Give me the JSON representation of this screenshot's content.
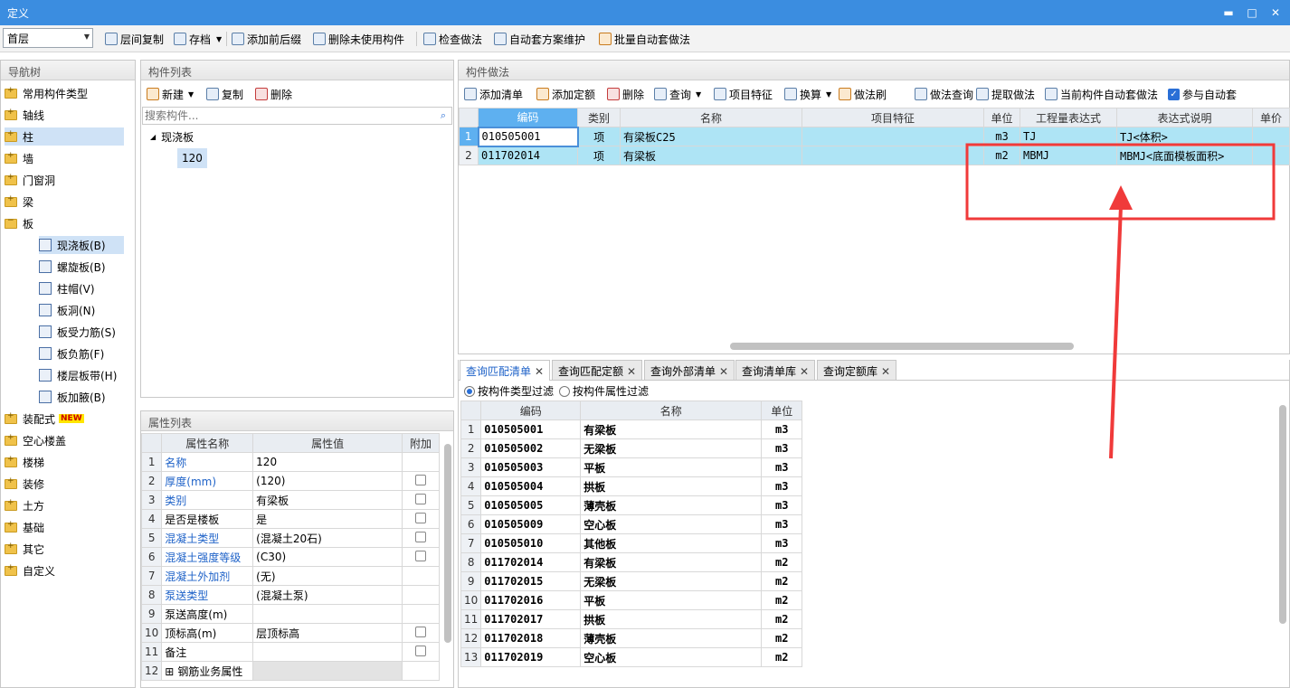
{
  "window": {
    "title": "定义",
    "min": "▬",
    "max": "□",
    "close": "✕"
  },
  "toolbar": {
    "floor": "首层",
    "buttons": [
      "层间复制",
      "存档",
      "添加前后缀",
      "删除未使用构件",
      "检查做法",
      "自动套方案维护",
      "批量自动套做法"
    ]
  },
  "nav": {
    "title": "导航树",
    "items": [
      {
        "label": "常用构件类型"
      },
      {
        "label": "轴线"
      },
      {
        "label": "柱"
      },
      {
        "label": "墙"
      },
      {
        "label": "门窗洞"
      },
      {
        "label": "梁"
      },
      {
        "label": "板"
      },
      {
        "label": "现浇板(B)"
      },
      {
        "label": "螺旋板(B)"
      },
      {
        "label": "柱帽(V)"
      },
      {
        "label": "板洞(N)"
      },
      {
        "label": "板受力筋(S)"
      },
      {
        "label": "板负筋(F)"
      },
      {
        "label": "楼层板带(H)"
      },
      {
        "label": "板加腋(B)"
      },
      {
        "label": "装配式",
        "badge": "NEW"
      },
      {
        "label": "空心楼盖"
      },
      {
        "label": "楼梯"
      },
      {
        "label": "装修"
      },
      {
        "label": "土方"
      },
      {
        "label": "基础"
      },
      {
        "label": "其它"
      },
      {
        "label": "自定义"
      }
    ]
  },
  "components": {
    "title": "构件列表",
    "new": "新建",
    "copy": "复制",
    "delete": "删除",
    "search_placeholder": "搜索构件...",
    "group": "现浇板",
    "item": "120"
  },
  "props": {
    "title": "属性列表",
    "headers": [
      "属性名称",
      "属性值",
      "附加"
    ],
    "rows": [
      {
        "n": "1",
        "name": "名称",
        "value": "120"
      },
      {
        "n": "2",
        "name": "厚度(mm)",
        "value": "(120)"
      },
      {
        "n": "3",
        "name": "类别",
        "value": "有梁板"
      },
      {
        "n": "4",
        "name": "是否是楼板",
        "value": "是"
      },
      {
        "n": "5",
        "name": "混凝土类型",
        "value": "(混凝土20石)"
      },
      {
        "n": "6",
        "name": "混凝土强度等级",
        "value": "(C30)"
      },
      {
        "n": "7",
        "name": "混凝土外加剂",
        "value": "(无)"
      },
      {
        "n": "8",
        "name": "泵送类型",
        "value": "(混凝土泵)"
      },
      {
        "n": "9",
        "name": "泵送高度(m)",
        "value": ""
      },
      {
        "n": "10",
        "name": "顶标高(m)",
        "value": "层顶标高"
      },
      {
        "n": "11",
        "name": "备注",
        "value": ""
      },
      {
        "n": "12",
        "name": "钢筋业务属性",
        "value": ""
      }
    ]
  },
  "method": {
    "title": "构件做法",
    "toolbar": [
      "添加清单",
      "添加定额",
      "删除",
      "查询",
      "项目特征",
      "换算",
      "做法刷",
      "做法查询",
      "提取做法",
      "当前构件自动套做法",
      "参与自动套"
    ],
    "headers": [
      "编码",
      "类别",
      "名称",
      "项目特征",
      "单位",
      "工程量表达式",
      "表达式说明",
      "单价"
    ],
    "rows": [
      {
        "n": "1",
        "code": "010505001",
        "type": "项",
        "name": "有梁板C25",
        "feature": "",
        "unit": "m3",
        "expr": "TJ",
        "desc": "TJ<体积>"
      },
      {
        "n": "2",
        "code": "011702014",
        "type": "项",
        "name": "有梁板",
        "feature": "",
        "unit": "m2",
        "expr": "MBMJ",
        "desc": "MBMJ<底面模板面积>"
      }
    ]
  },
  "query": {
    "tabs": [
      "查询匹配清单",
      "查询匹配定额",
      "查询外部清单",
      "查询清单库",
      "查询定额库"
    ],
    "filter1": "按构件类型过滤",
    "filter2": "按构件属性过滤",
    "headers": [
      "编码",
      "名称",
      "单位"
    ],
    "rows": [
      {
        "n": "1",
        "code": "010505001",
        "name": "有梁板",
        "unit": "m3"
      },
      {
        "n": "2",
        "code": "010505002",
        "name": "无梁板",
        "unit": "m3"
      },
      {
        "n": "3",
        "code": "010505003",
        "name": "平板",
        "unit": "m3"
      },
      {
        "n": "4",
        "code": "010505004",
        "name": "拱板",
        "unit": "m3"
      },
      {
        "n": "5",
        "code": "010505005",
        "name": "薄壳板",
        "unit": "m3"
      },
      {
        "n": "6",
        "code": "010505009",
        "name": "空心板",
        "unit": "m3"
      },
      {
        "n": "7",
        "code": "010505010",
        "name": "其他板",
        "unit": "m3"
      },
      {
        "n": "8",
        "code": "011702014",
        "name": "有梁板",
        "unit": "m2"
      },
      {
        "n": "9",
        "code": "011702015",
        "name": "无梁板",
        "unit": "m2"
      },
      {
        "n": "10",
        "code": "011702016",
        "name": "平板",
        "unit": "m2"
      },
      {
        "n": "11",
        "code": "011702017",
        "name": "拱板",
        "unit": "m2"
      },
      {
        "n": "12",
        "code": "011702018",
        "name": "薄壳板",
        "unit": "m2"
      },
      {
        "n": "13",
        "code": "011702019",
        "name": "空心板",
        "unit": "m2"
      }
    ]
  },
  "colors": {
    "titlebar": "#3b8de0",
    "selected_row": "#aee4f5",
    "annotation": "#f03a3a"
  }
}
